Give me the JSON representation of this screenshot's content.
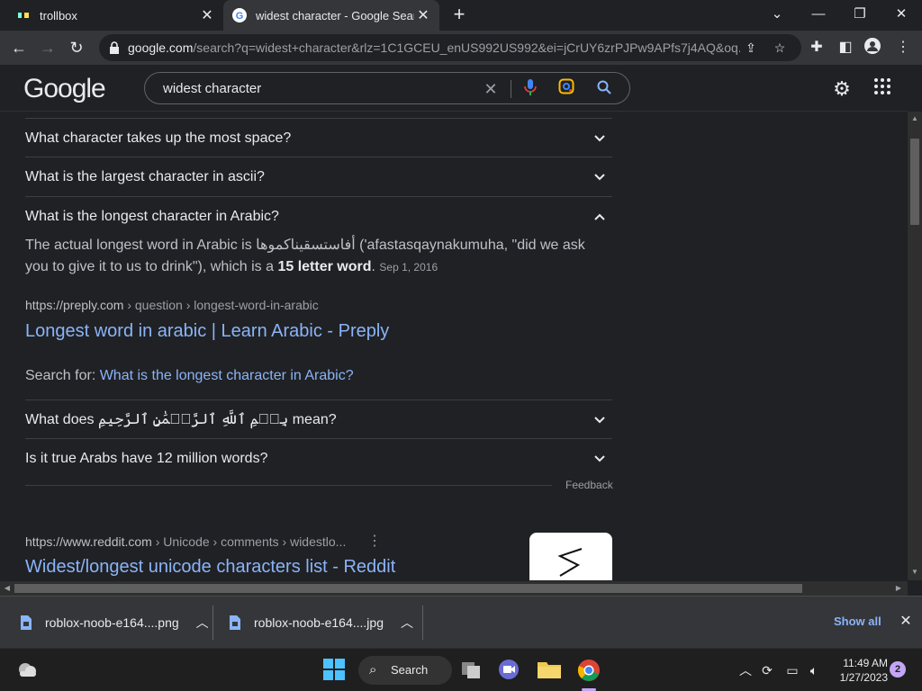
{
  "tabs": [
    {
      "title": "trollbox",
      "active": false
    },
    {
      "title": "widest character - Google Search",
      "active": true
    }
  ],
  "address_bar": {
    "host": "google.com",
    "path": "/search?q=widest+character&rlz=1C1GCEU_enUS992US992&ei=jCrUY6zrPJPw9APfs7j4AQ&oq..."
  },
  "google": {
    "logo": "Google",
    "search_query": "widest character"
  },
  "people_also_ask": [
    {
      "question": "What character takes up the most space?",
      "expanded": false
    },
    {
      "question": "What is the largest character in ascii?",
      "expanded": false
    },
    {
      "question": "What is the longest character in Arabic?",
      "expanded": true
    },
    {
      "question": "What does بِسۡمِ ٱللَّهِ ٱلرَّحۡمَٰنِ ٱلرَّحِيمِ mean?",
      "expanded": false
    },
    {
      "question": "Is it true Arabs have 12 million words?",
      "expanded": false
    }
  ],
  "answer": {
    "text_before": "The actual longest word in Arabic is ",
    "arabic_word": "أفاستسقيناكموها",
    "text_middle": " ('afastasqaynakumuha, \"did we ask you to give it to us to drink\"), which is a ",
    "bold": "15 letter word",
    "text_after": ".",
    "date": "Sep 1, 2016",
    "source_site": "https://preply.com",
    "source_crumb": " › question › longest-word-in-arabic",
    "link_title": "Longest word in arabic | Learn Arabic - Preply",
    "search_for_label": "Search for: ",
    "search_for_link": "What is the longest character in Arabic?"
  },
  "feedback_label": "Feedback",
  "next_result": {
    "site": "https://www.reddit.com",
    "crumb": " › Unicode › comments › widestlo...",
    "title": "Widest/longest unicode characters list - Reddit"
  },
  "downloads": [
    {
      "name": "roblox-noob-e164....png"
    },
    {
      "name": "roblox-noob-e164....jpg"
    }
  ],
  "download_bar": {
    "show_all": "Show all"
  },
  "taskbar": {
    "search_label": "Search",
    "time": "11:49 AM",
    "date": "1/27/2023",
    "notification_count": "2"
  },
  "colors": {
    "link": "#8ab4f8",
    "background": "#202124",
    "toolbar": "#35363a"
  }
}
